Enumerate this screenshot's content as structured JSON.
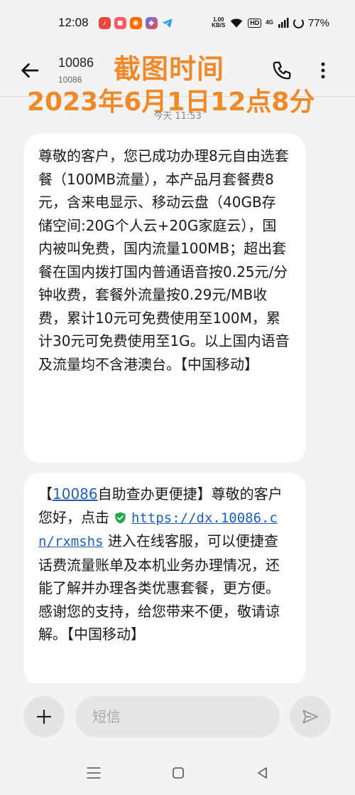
{
  "status_bar": {
    "time": "12:08",
    "net_speed_value": "1.00",
    "net_speed_unit": "KB/S",
    "hd": "HD",
    "signal_label": "4G",
    "battery": "77%"
  },
  "header": {
    "contact_name": "10086",
    "contact_sub": "10086"
  },
  "watermark": {
    "line1": "截图时间",
    "line2": "2023年6月1日12点8分"
  },
  "date_label": "今天 11:53",
  "messages": [
    {
      "text": "尊敬的客户，您已成功办理8元自由选套餐（100MB流量），本产品月套餐费8元，含来电显示、移动云盘（40GB存储空间:20G个人云+20G家庭云），国内被叫免费，国内流量100MB；超出套餐在国内拨打国内普通语音按0.25元/分钟收费，套餐外流量按0.29元/MB收费，累计10元可免费使用至100M，累计30元可免费使用至1G。以上国内语音及流量均不含港澳台。【中国移动】"
    },
    {
      "prefix": "【",
      "link_number": "10086",
      "mid": "自助查办更便捷】尊敬的客户您好，点击",
      "url": "https://dx.10086.cn/rxmshs",
      "suffix": " 进入在线客服，可以便捷查话费流量账单及本机业务办理情况，还能了解并办理各类优惠套餐，更方便。感谢您的支持，给您带来不便，敬请谅解。【中国移动】"
    }
  ],
  "input": {
    "placeholder": "短信"
  },
  "colors": {
    "watermark": "#ef8a2a",
    "link": "#1f5fb8",
    "shield": "#22a84a",
    "background": "#f3f3f3"
  },
  "icons": [
    "back-arrow-icon",
    "phone-icon",
    "more-vertical-icon",
    "shield-check-icon",
    "plus-icon",
    "send-icon",
    "menu-icon",
    "home-icon",
    "back-triangle-icon"
  ]
}
